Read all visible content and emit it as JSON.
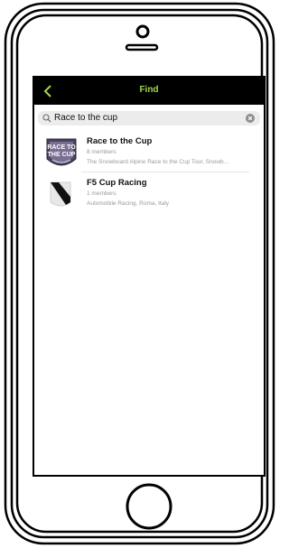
{
  "header": {
    "title": "Find"
  },
  "search": {
    "value": "Race to the cup"
  },
  "results": [
    {
      "title": "Race to the Cup",
      "members": "8 members",
      "description": "The Snowboard Alpine Race to the Cup Tour, Snowb…",
      "logo_text_top": "RACE TO",
      "logo_text_bottom": "THE CUP"
    },
    {
      "title": "F5 Cup Racing",
      "members": "1 members",
      "description": "Automobile Racing, Roma, Italy"
    }
  ],
  "colors": {
    "accent": "#a6d64a",
    "navbar": "#000000",
    "search_bg": "#ececec",
    "muted_text": "#9a9a9a"
  }
}
